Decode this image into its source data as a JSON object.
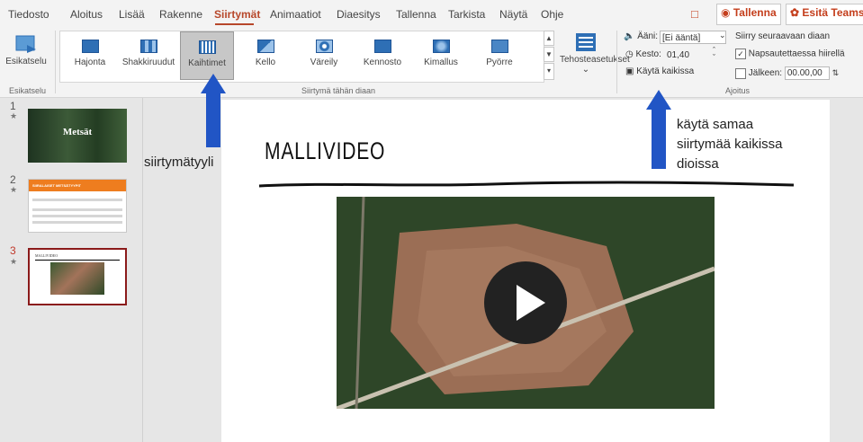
{
  "menu": {
    "tabs": [
      "Tiedosto",
      "Aloitus",
      "Lisää",
      "Rakenne",
      "Siirtymät",
      "Animaatiot",
      "Diaesitys",
      "Tallenna",
      "Tarkista",
      "Näytä",
      "Ohje"
    ],
    "record_label": "Tallenna",
    "present_label": "Esitä Teamsissa"
  },
  "ribbon": {
    "preview_label": "Esikatselu",
    "preview_group": "Esikatselu",
    "transitions": [
      "Hajonta",
      "Shakkiruudut",
      "Kaihtimet",
      "Kello",
      "Väreily",
      "Kennosto",
      "Kimallus",
      "Pyörre"
    ],
    "selected_transition": "Kaihtimet",
    "effect_options_label": "Tehosteasetukset",
    "transitions_group": "Siirtymä tähän diaan",
    "sound_label": "Ääni:",
    "sound_value": "[Ei ääntä]",
    "duration_label": "Kesto:",
    "duration_value": "01,40",
    "apply_all_label": "Käytä kaikissa",
    "advance_label": "Siirry seuraavaan diaan",
    "on_click_label": "Napsautettaessa hiirellä",
    "after_label": "Jälkeen:",
    "after_value": "00.00,00",
    "timing_group": "Ajoitus"
  },
  "thumbnails": {
    "slides": [
      {
        "num": "1",
        "title": "Metsät"
      },
      {
        "num": "2",
        "title": "SIIRALAISET METSÄTYYPIT"
      },
      {
        "num": "3",
        "title": "MALLIVIDEO"
      }
    ]
  },
  "slide": {
    "title": "MALLIVIDEO"
  },
  "annotations": {
    "left": "siirtymätyyli",
    "right_1": "käytä samaa",
    "right_2": "siirtymää kaikissa",
    "right_3": "dioissa"
  },
  "colors": {
    "accent": "#b7472a",
    "arrow": "#2155c5",
    "transition_icon": "#2e6fb5"
  }
}
